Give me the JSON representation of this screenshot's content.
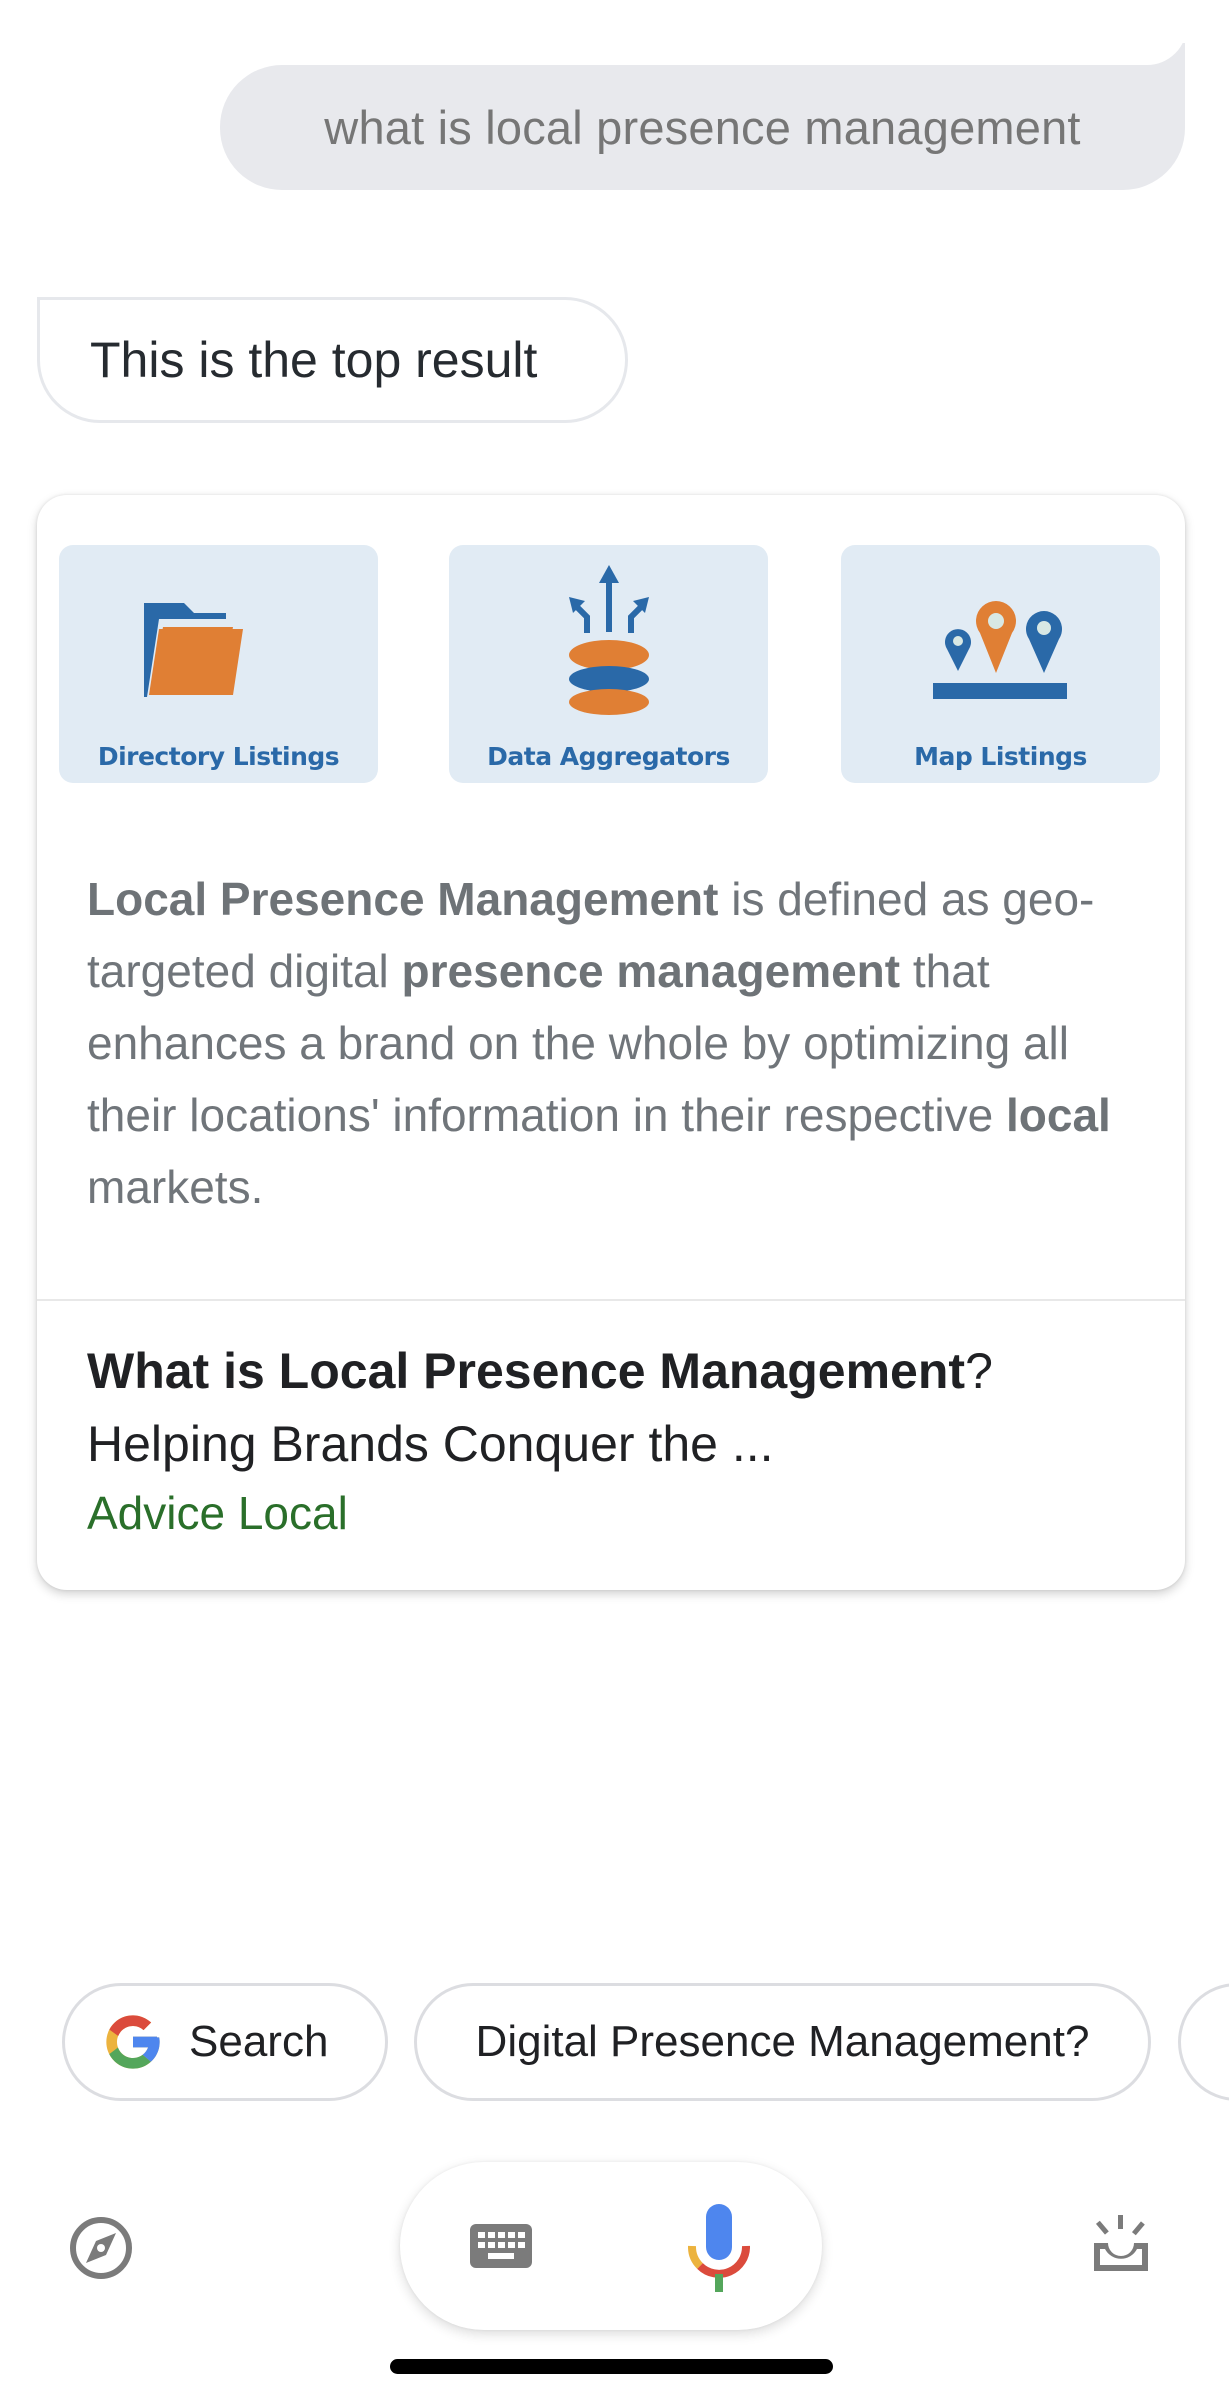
{
  "conversation": {
    "user_query": "what is local presence management",
    "assistant_reply": "This is the top result"
  },
  "result_card": {
    "tiles": [
      {
        "label": "Directory Listings",
        "icon": "folder-icon"
      },
      {
        "label": "Data Aggregators",
        "icon": "database-arrows-icon"
      },
      {
        "label": "Map Listings",
        "icon": "map-pins-icon"
      }
    ],
    "description": {
      "parts": [
        {
          "text": "Local Presence Management",
          "bold": true
        },
        {
          "text": " is defined as geo-targeted digital ",
          "bold": false
        },
        {
          "text": "presence management",
          "bold": true
        },
        {
          "text": " that enhances a brand on the whole by optimizing all their locations' information in their respective ",
          "bold": false
        },
        {
          "text": "local",
          "bold": true
        },
        {
          "text": " markets.",
          "bold": false
        }
      ]
    },
    "result_title_bold": "What is Local Presence Management",
    "result_title_rest": "?",
    "result_subtitle": "Helping Brands Conquer the ...",
    "result_source": "Advice Local"
  },
  "suggestions": [
    {
      "label": "Search",
      "icon": "google-g-icon"
    },
    {
      "label": "Digital Presence Management?"
    },
    {
      "label": ""
    }
  ],
  "bottom_bar": {
    "left_icon": "explore-compass-icon",
    "keyboard_icon": "keyboard-icon",
    "mic_icon": "microphone-icon",
    "right_icon": "updates-tray-icon"
  },
  "colors": {
    "user_bubble_bg": "#e8e9ed",
    "tile_bg": "#e1ebf4",
    "tile_blue": "#2a69a8",
    "tile_orange": "#e07f34",
    "source_green": "#2a6f2a",
    "google_blue": "#4e86ee",
    "google_red": "#db4b3c",
    "google_yellow": "#ecb33e",
    "google_green": "#54a65b"
  }
}
